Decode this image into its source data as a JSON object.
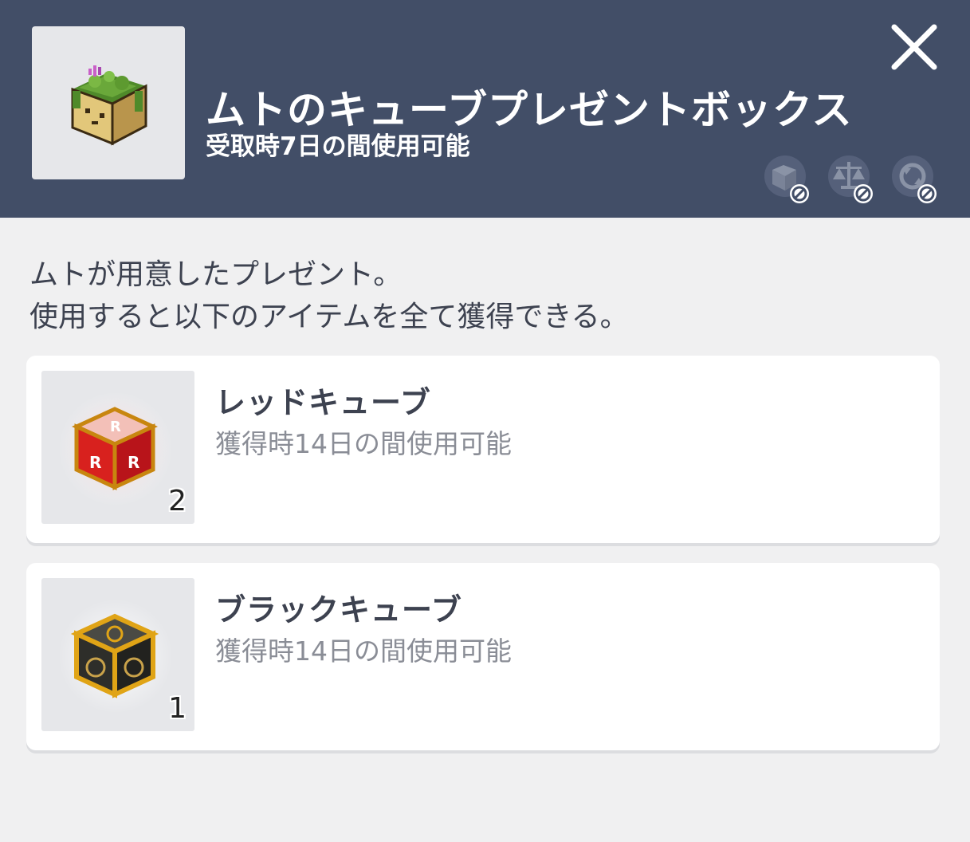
{
  "header": {
    "title": "ムトのキューブプレゼントボックス",
    "subtitle": "受取時7日の間使用可能",
    "icon": "cube-present-box-icon",
    "restriction_icons": [
      "no-trade-icon",
      "no-sell-icon",
      "no-exchange-icon"
    ],
    "close_icon": "close-icon"
  },
  "description": {
    "line1": "ムトが用意したプレゼント。",
    "line2": "使用すると以下のアイテムを全て獲得できる。"
  },
  "items": [
    {
      "name": "レッドキューブ",
      "duration": "獲得時14日の間使用可能",
      "quantity": "2",
      "icon": "red-cube-icon"
    },
    {
      "name": "ブラックキューブ",
      "duration": "獲得時14日の間使用可能",
      "quantity": "1",
      "icon": "black-cube-icon"
    }
  ],
  "colors": {
    "header_bg": "#424e67",
    "page_bg": "#f0f0f1",
    "card_bg": "#ffffff",
    "text": "#3d4250",
    "subtext": "#8a8d96"
  }
}
